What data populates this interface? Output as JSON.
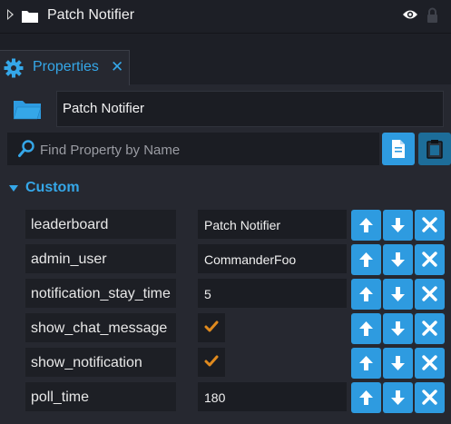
{
  "hierarchy": {
    "item_title": "Patch Notifier"
  },
  "tab": {
    "label": "Properties",
    "close_glyph": "✕"
  },
  "object": {
    "name": "Patch Notifier"
  },
  "search": {
    "placeholder": "Find Property by Name",
    "value": ""
  },
  "section": {
    "label": "Custom"
  },
  "properties": [
    {
      "name": "leaderboard",
      "type": "text",
      "value": "Patch Notifier"
    },
    {
      "name": "admin_user",
      "type": "text",
      "value": "CommanderFoo"
    },
    {
      "name": "notification_stay_time",
      "type": "text",
      "value": "5"
    },
    {
      "name": "show_chat_message",
      "type": "bool",
      "value": true
    },
    {
      "name": "show_notification",
      "type": "bool",
      "value": true
    },
    {
      "name": "poll_time",
      "type": "text",
      "value": "180"
    }
  ],
  "colors": {
    "accent": "#35a7e8",
    "button": "#2e9be0",
    "checkmark": "#e08a1e",
    "background": "#262830"
  },
  "icons": [
    "expand-arrow-icon",
    "folder-icon",
    "eye-icon",
    "lock-icon",
    "gear-icon",
    "close-icon",
    "search-icon",
    "copy-icon",
    "paste-icon",
    "arrow-up-icon",
    "arrow-down-icon",
    "delete-icon",
    "checkmark-icon"
  ]
}
